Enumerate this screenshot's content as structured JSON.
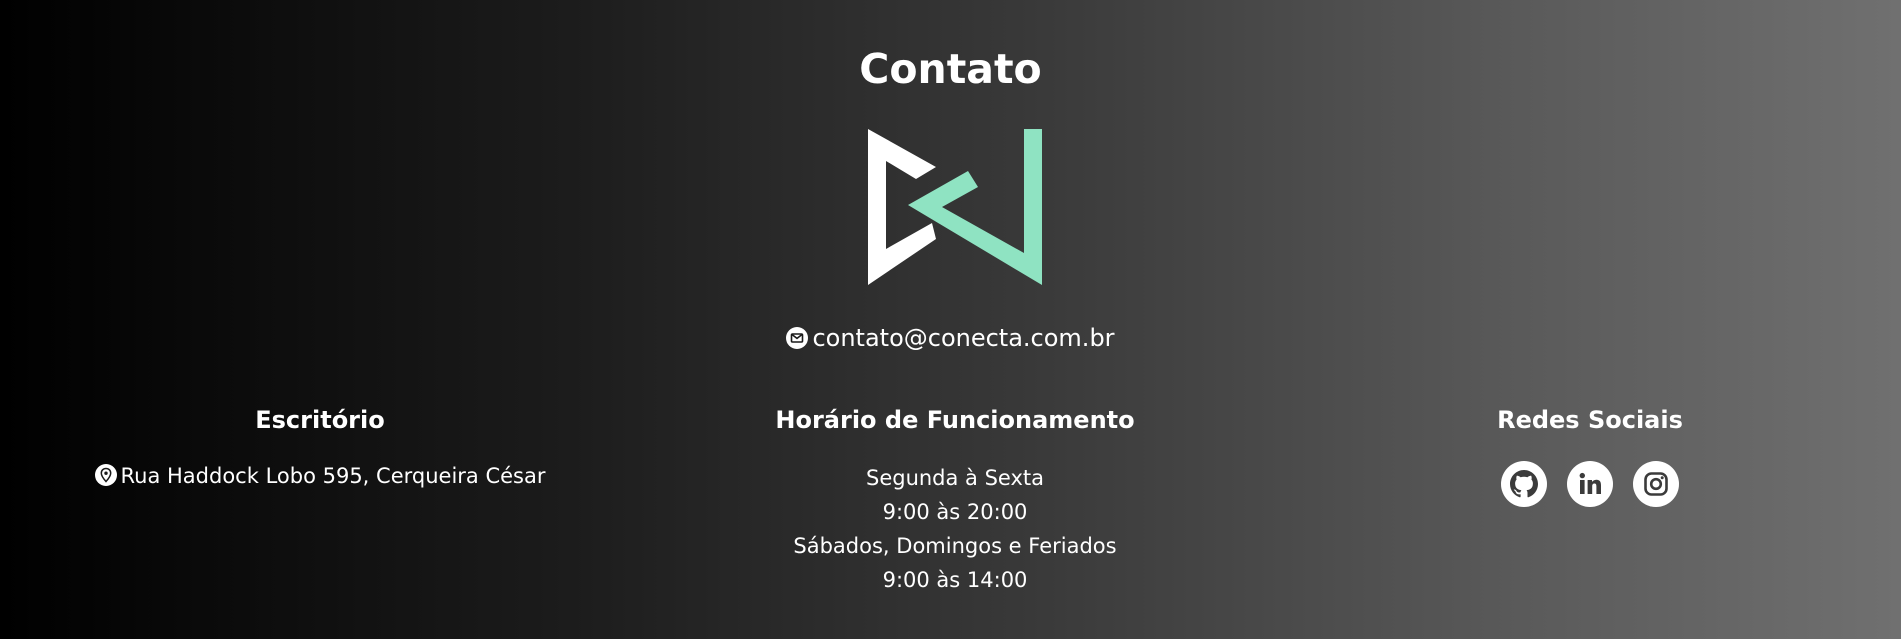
{
  "contact": {
    "title": "Contato",
    "email": "contato@conecta.com.br"
  },
  "office": {
    "heading": "Escritório",
    "address": "Rua Haddock Lobo 595, Cerqueira César"
  },
  "hours": {
    "heading": "Horário de Funcionamento",
    "lines": [
      "Segunda à Sexta",
      "9:00 às 20:00",
      "Sábados, Domingos e Feriados",
      "9:00 às 14:00"
    ]
  },
  "social": {
    "heading": "Redes Sociais",
    "links": [
      {
        "icon": "github-icon"
      },
      {
        "icon": "linkedin-icon"
      },
      {
        "icon": "instagram-icon"
      }
    ]
  },
  "colors": {
    "accent": "#8fe3c2",
    "text": "#ffffff",
    "gradient_start": "#000000",
    "gradient_end": "#707070"
  }
}
